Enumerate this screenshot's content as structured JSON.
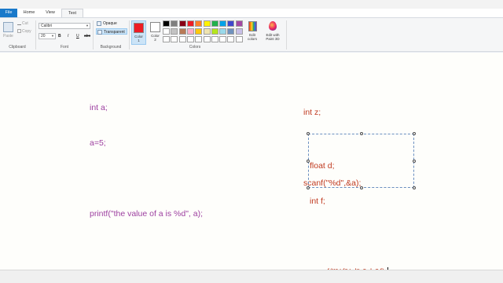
{
  "tabs": {
    "file": "File",
    "home": "Home",
    "view": "View",
    "text": "Text"
  },
  "clipboard": {
    "paste": "Paste",
    "cut": "Cut",
    "copy": "Copy",
    "group_label": "Clipboard"
  },
  "font": {
    "family": "Calibri",
    "size": "20",
    "bold": "B",
    "italic": "I",
    "underline": "U",
    "strikethrough": "abc",
    "group_label": "Font"
  },
  "background": {
    "opaque": "Opaque",
    "transparent": "Transparent",
    "selected": "Transparent",
    "group_label": "Background"
  },
  "colors": {
    "color1_label": "Color",
    "color1_num": "1",
    "color1_value": "#ed1c24",
    "color2_label": "Color",
    "color2_num": "2",
    "color2_value": "#ffffff",
    "palette_row1": [
      "#000000",
      "#7f7f7f",
      "#880015",
      "#ed1c24",
      "#ff7f27",
      "#fff200",
      "#22b14c",
      "#00a2e8",
      "#3f48cc",
      "#a349a4"
    ],
    "palette_row2": [
      "#ffffff",
      "#c3c3c3",
      "#b97a57",
      "#ffaec9",
      "#ffc90e",
      "#efe4b0",
      "#b5e61d",
      "#99d9ea",
      "#7092be",
      "#c8bfe7"
    ],
    "palette_row3": [
      "#ffffff",
      "#ffffff",
      "#ffffff",
      "#ffffff",
      "#ffffff",
      "#ffffff",
      "#ffffff",
      "#ffffff",
      "#ffffff",
      "#ffffff"
    ],
    "edit_colors": "Edit colors",
    "edit_with_paint3d": "Edit with Paint 3D",
    "group_label": "Colors"
  },
  "canvas": {
    "left_block": [
      "int a;",
      "a=5;",
      "",
      "printf(\"the value of a is %d\", a);"
    ],
    "right_block": [
      "int z;",
      "",
      "scanf(\"%d\",&a);"
    ],
    "textbox_lines": [
      "float d;",
      "int f;",
      "",
      "scanf(\"%f%d\",&d,&f);"
    ],
    "left_color": "#9d3fa0",
    "right_color": "#c03a20"
  }
}
